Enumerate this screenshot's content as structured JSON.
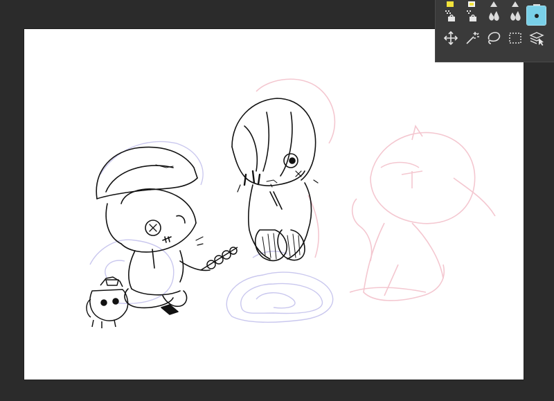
{
  "app": {
    "canvas_bg": "#ffffff",
    "workspace_bg": "#2b2b2b",
    "palette_bg": "#3a3a3a",
    "accent": "#79d0e8"
  },
  "tool_palette": {
    "rows": [
      [
        {
          "name": "yellow-tool-icon",
          "active": false
        },
        {
          "name": "yellow-tool-icon",
          "active": false
        },
        {
          "name": "brush-tool-icon",
          "active": false
        },
        {
          "name": "brush-tool-icon",
          "active": false
        },
        {
          "name": "tool-icon",
          "active": false
        }
      ],
      [
        {
          "name": "fill-tool-icon",
          "active": false
        },
        {
          "name": "fill-tool-icon",
          "active": false
        },
        {
          "name": "water-drop-icon",
          "active": false
        },
        {
          "name": "water-drop-icon",
          "active": false
        },
        {
          "name": "dot-brush-icon",
          "active": true
        },
        {
          "name": "triangle-tool-icon",
          "active": false
        }
      ],
      [
        {
          "name": "move-tool-icon",
          "active": false
        },
        {
          "name": "magic-wand-icon",
          "active": false
        },
        {
          "name": "lasso-icon",
          "active": false
        },
        {
          "name": "rect-select-icon",
          "active": false
        },
        {
          "name": "layer-select-icon",
          "active": false
        }
      ]
    ]
  },
  "artwork": {
    "line_color": "#111111",
    "sketch_pink": "#f4c7d0",
    "sketch_lavender": "#c9c7ee"
  }
}
